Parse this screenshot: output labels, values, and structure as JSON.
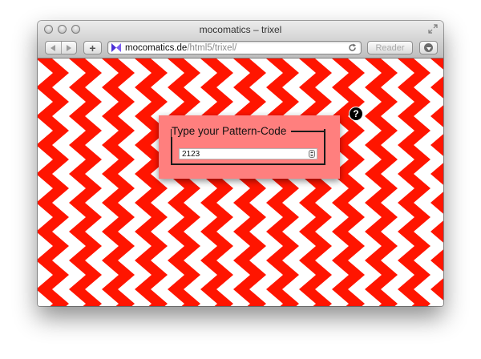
{
  "window": {
    "title": "mocomatics – trixel"
  },
  "toolbar": {
    "add_label": "+",
    "url_host": "mocomatics.de",
    "url_path": "/html5/trixel/",
    "reader_label": "Reader"
  },
  "page": {
    "pattern_colors": [
      "#ff1500",
      "#ffffff"
    ],
    "dialog": {
      "legend": "Type your Pattern-Code",
      "input_value": "2123"
    },
    "help_label": "?"
  },
  "icons": {
    "favicon": "bowtie-icon",
    "reload": "reload-icon",
    "download": "download-icon",
    "resize": "fullscreen-icon"
  }
}
